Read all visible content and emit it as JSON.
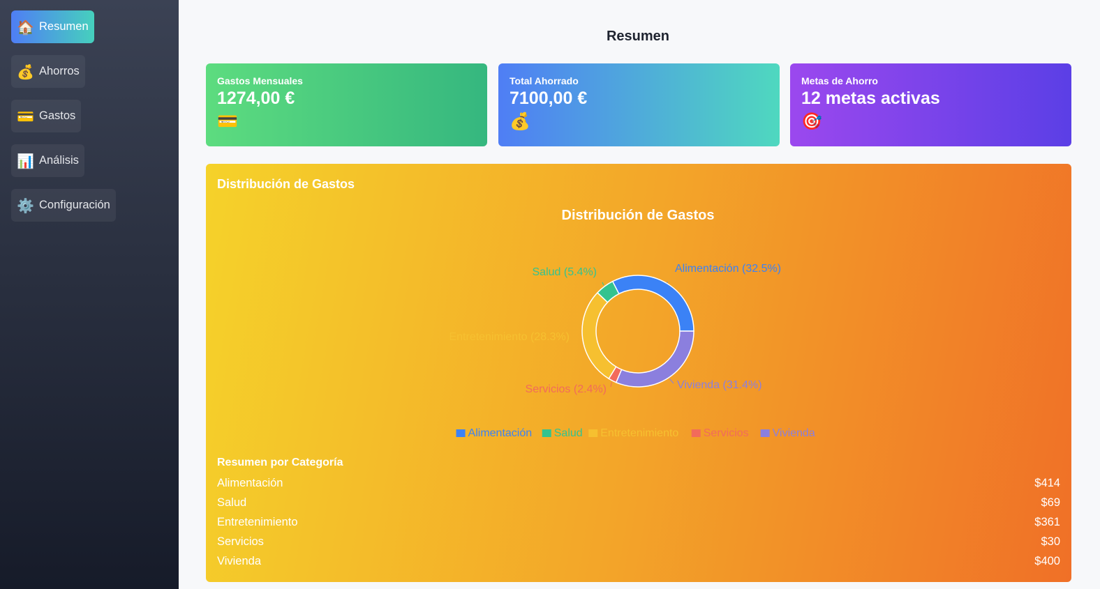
{
  "sidebar": {
    "items": [
      {
        "label": "Resumen",
        "icon": "🏠",
        "icon_name": "house-icon",
        "active": true
      },
      {
        "label": "Ahorros",
        "icon": "💰",
        "icon_name": "money-bag-icon",
        "active": false
      },
      {
        "label": "Gastos",
        "icon": "💳",
        "icon_name": "credit-card-icon",
        "active": false
      },
      {
        "label": "Análisis",
        "icon": "📊",
        "icon_name": "bar-chart-icon",
        "active": false
      },
      {
        "label": "Configuración",
        "icon": "⚙️",
        "icon_name": "gear-icon",
        "active": false
      }
    ]
  },
  "page": {
    "title": "Resumen"
  },
  "cards": [
    {
      "label": "Gastos Mensuales",
      "value": "1274,00 €",
      "icon": "💳",
      "icon_name": "credit-card-icon"
    },
    {
      "label": "Total Ahorrado",
      "value": "7100,00 €",
      "icon": "💰",
      "icon_name": "money-bag-icon"
    },
    {
      "label": "Metas de Ahorro",
      "value": "12 metas activas",
      "icon": "🎯",
      "icon_name": "target-icon"
    }
  ],
  "distribution": {
    "heading": "Distribución de Gastos",
    "summary_title": "Resumen por Categoría",
    "summary": [
      {
        "name": "Alimentación",
        "amount": "$414"
      },
      {
        "name": "Salud",
        "amount": "$69"
      },
      {
        "name": "Entretenimiento",
        "amount": "$361"
      },
      {
        "name": "Servicios",
        "amount": "$30"
      },
      {
        "name": "Vivienda",
        "amount": "$400"
      }
    ]
  },
  "chart_data": {
    "type": "pie",
    "title": "Distribución de Gastos",
    "legend_position": "bottom",
    "slices": [
      {
        "name": "Alimentación",
        "value": 414,
        "percent_label": "Alimentación (32.5%)",
        "color": "#3b82f6"
      },
      {
        "name": "Vivienda",
        "value": 400,
        "percent_label": "Vivienda (31.4%)",
        "color": "#8b7fde"
      },
      {
        "name": "Servicios",
        "value": 30,
        "percent_label": "Servicios (2.4%)",
        "color": "#f26b5b"
      },
      {
        "name": "Entretenimiento",
        "value": 361,
        "percent_label": "Entretenimiento (28.3%)",
        "color": "#f6c030"
      },
      {
        "name": "Salud",
        "value": 69,
        "percent_label": "Salud (5.4%)",
        "color": "#34c38f"
      }
    ],
    "legend_order": [
      "Alimentación",
      "Salud",
      "Entretenimiento",
      "Servicios",
      "Vivienda"
    ]
  }
}
